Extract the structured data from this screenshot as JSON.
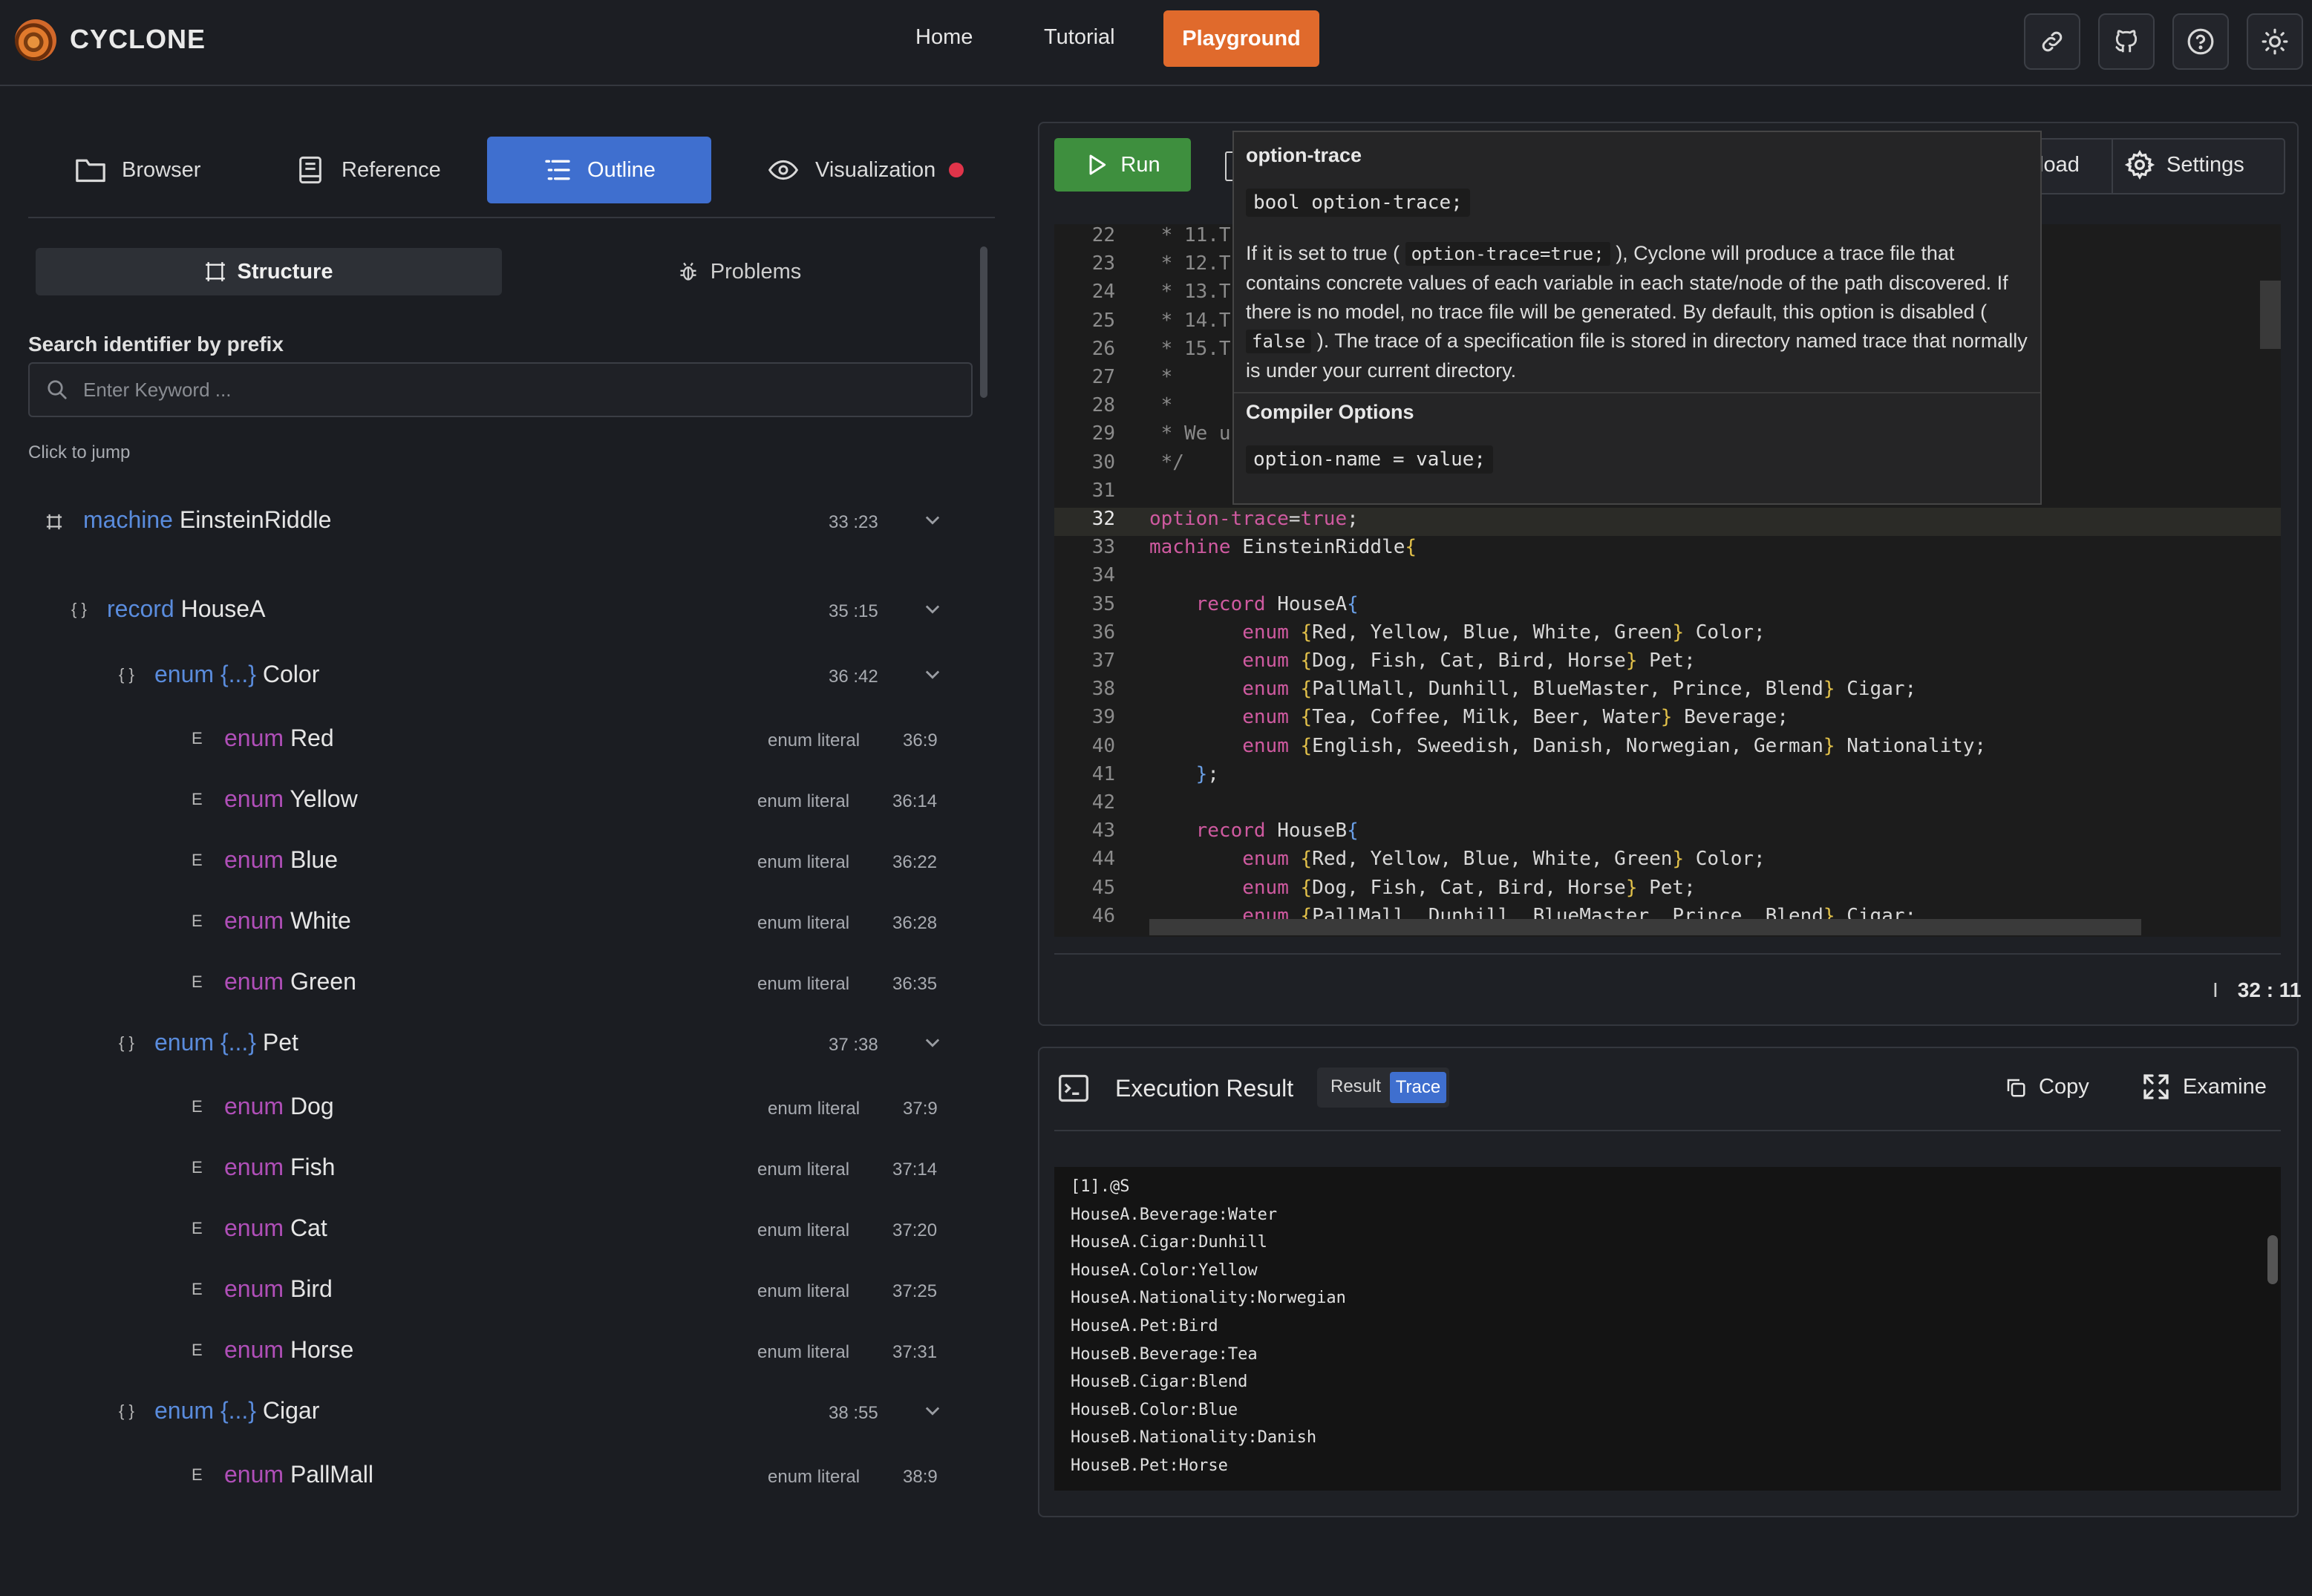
{
  "app": {
    "brand": "CYCLONE"
  },
  "nav": {
    "home": "Home",
    "tutorial": "Tutorial",
    "playground": "Playground"
  },
  "left_tabs": {
    "browser": "Browser",
    "reference": "Reference",
    "outline": "Outline",
    "visualization": "Visualization"
  },
  "subtabs": {
    "structure": "Structure",
    "problems": "Problems"
  },
  "search": {
    "label": "Search identifier by prefix",
    "placeholder": "Enter Keyword ...",
    "value": ""
  },
  "hint": "Click to jump",
  "outline": {
    "machine": {
      "kw": "machine",
      "name": "EinsteinRiddle",
      "pos": "33 :23"
    },
    "record": {
      "kw": "record",
      "name": "HouseA",
      "pos": "35 :15"
    },
    "enums": [
      {
        "kw": "enum {...}",
        "name": "Color",
        "pos": "36 :42",
        "literals": [
          {
            "name": "Red",
            "pos": "36:9"
          },
          {
            "name": "Yellow",
            "pos": "36:14"
          },
          {
            "name": "Blue",
            "pos": "36:22"
          },
          {
            "name": "White",
            "pos": "36:28"
          },
          {
            "name": "Green",
            "pos": "36:35"
          }
        ]
      },
      {
        "kw": "enum {...}",
        "name": "Pet",
        "pos": "37 :38",
        "literals": [
          {
            "name": "Dog",
            "pos": "37:9"
          },
          {
            "name": "Fish",
            "pos": "37:14"
          },
          {
            "name": "Cat",
            "pos": "37:20"
          },
          {
            "name": "Bird",
            "pos": "37:25"
          },
          {
            "name": "Horse",
            "pos": "37:31"
          }
        ]
      },
      {
        "kw": "enum {...}",
        "name": "Cigar",
        "pos": "38 :55",
        "literals": [
          {
            "name": "PallMall",
            "pos": "38:9"
          }
        ]
      }
    ],
    "literal_kw": "enum",
    "literal_type": "enum literal",
    "literal_icon": "E",
    "record_icon": "{ }"
  },
  "toolbar": {
    "run": "Run",
    "download_partial": "load",
    "settings": "Settings"
  },
  "editor": {
    "lines": [
      {
        "n": "22",
        "html": "<span class='cm'> * 11.T</span>"
      },
      {
        "n": "23",
        "html": "<span class='cm'> * 12.T</span>"
      },
      {
        "n": "24",
        "html": "<span class='cm'> * 13.T</span>"
      },
      {
        "n": "25",
        "html": "<span class='cm'> * 14.T</span>"
      },
      {
        "n": "26",
        "html": "<span class='cm'> * 15.T</span>"
      },
      {
        "n": "27",
        "html": "<span class='cm'> *</span>"
      },
      {
        "n": "28",
        "html": "<span class='cm'> *</span>"
      },
      {
        "n": "29",
        "html": "<span class='cm'> * We u</span>"
      },
      {
        "n": "30",
        "html": "<span class='cm'> */</span>"
      },
      {
        "n": "31",
        "html": ""
      },
      {
        "n": "32",
        "html": "<span class='k'>option-trace</span>=<span class='k'>true</span>;",
        "current": true
      },
      {
        "n": "33",
        "html": "<span class='k'>machine</span> EinsteinRiddle<span class='b'>{</span>"
      },
      {
        "n": "34",
        "html": ""
      },
      {
        "n": "35",
        "html": "    <span class='k'>record</span> HouseA<span class='c2'>{</span>"
      },
      {
        "n": "36",
        "html": "        <span class='k'>enum</span> <span class='b'>{</span>Red, Yellow, Blue, White, Green<span class='b'>}</span> Color;"
      },
      {
        "n": "37",
        "html": "        <span class='k'>enum</span> <span class='b'>{</span>Dog, Fish, Cat, Bird, Horse<span class='b'>}</span> Pet;"
      },
      {
        "n": "38",
        "html": "        <span class='k'>enum</span> <span class='b'>{</span>PallMall, Dunhill, BlueMaster, Prince, Blend<span class='b'>}</span> Cigar;"
      },
      {
        "n": "39",
        "html": "        <span class='k'>enum</span> <span class='b'>{</span>Tea, Coffee, Milk, Beer, Water<span class='b'>}</span> Beverage;"
      },
      {
        "n": "40",
        "html": "        <span class='k'>enum</span> <span class='b'>{</span>English, Sweedish, Danish, Norwegian, German<span class='b'>}</span> Nationality;"
      },
      {
        "n": "41",
        "html": "    <span class='c2'>}</span>;"
      },
      {
        "n": "42",
        "html": ""
      },
      {
        "n": "43",
        "html": "    <span class='k'>record</span> HouseB<span class='c2'>{</span>"
      },
      {
        "n": "44",
        "html": "        <span class='k'>enum</span> <span class='b'>{</span>Red, Yellow, Blue, White, Green<span class='b'>}</span> Color;"
      },
      {
        "n": "45",
        "html": "        <span class='k'>enum</span> <span class='b'>{</span>Dog, Fish, Cat, Bird, Horse<span class='b'>}</span> Pet;"
      },
      {
        "n": "46",
        "html": "        <span class='k'>enum</span> <span class='b'>{</span>PallMall, Dunhill, BlueMaster, Prince, Blend<span class='b'>}</span> Cigar;"
      }
    ],
    "cursor": "32 : 11"
  },
  "tooltip": {
    "title": "option-trace",
    "signature": "bool option-trace;",
    "body_1": "If it is set to true (",
    "body_code1": "option-trace=true;",
    "body_2": "), Cyclone will produce a trace file that contains concrete values of each variable in each state/node of the path discovered. If there is no model, no trace file will be generated. By default, this option is disabled (",
    "body_code2": "false",
    "body_3": "). The trace of a specification file is stored in directory named trace that normally is under your current directory.",
    "section": "Compiler Options",
    "section_code": "option-name = value;"
  },
  "exec": {
    "title": "Execution Result",
    "seg_result": "Result",
    "seg_trace": "Trace",
    "copy": "Copy",
    "examine": "Examine",
    "output": [
      "[1].@S",
      "HouseA.Beverage:Water",
      "HouseA.Cigar:Dunhill",
      "HouseA.Color:Yellow",
      "HouseA.Nationality:Norwegian",
      "HouseA.Pet:Bird",
      "HouseB.Beverage:Tea",
      "HouseB.Cigar:Blend",
      "HouseB.Color:Blue",
      "HouseB.Nationality:Danish",
      "HouseB.Pet:Horse"
    ]
  },
  "colors": {
    "accent": "#e06a2c",
    "primary": "#3f6fcf",
    "run": "#3e8f3e",
    "indicator": "#e0344a"
  }
}
